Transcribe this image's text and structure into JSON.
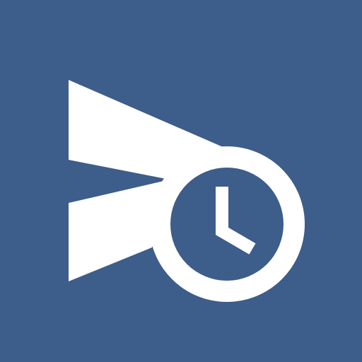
{
  "icon": {
    "name": "send-clock-icon",
    "background_color": "#3d5d8b",
    "foreground_color": "#ffffff",
    "parts": [
      "paper-plane-icon",
      "clock-icon"
    ]
  }
}
